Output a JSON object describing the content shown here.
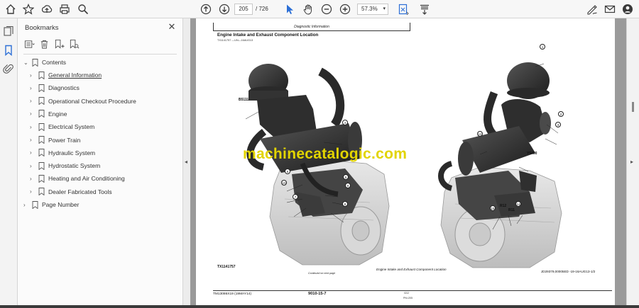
{
  "toolbar": {
    "current_page": "205",
    "page_total": "/ 726",
    "zoom": "57.3%",
    "icons": [
      "home-icon",
      "bookmark-star-icon",
      "upload-icon",
      "print-icon",
      "zoom-search-icon",
      "page-up-icon",
      "page-down-icon",
      "select-cursor-icon",
      "hand-tool-icon",
      "zoom-out-icon",
      "zoom-in-icon",
      "fit-page-icon",
      "scroll-mode-icon",
      "sign-icon",
      "mail-icon",
      "account-icon"
    ]
  },
  "left_rail": {
    "icons": [
      "pages-icon",
      "bookmarks-icon",
      "attachment-icon"
    ]
  },
  "bookmarks": {
    "title": "Bookmarks",
    "root": "Contents",
    "items": [
      {
        "label": "General Information",
        "active": true
      },
      {
        "label": "Diagnostics"
      },
      {
        "label": "Operational Checkout Procedure"
      },
      {
        "label": "Engine"
      },
      {
        "label": "Electrical System"
      },
      {
        "label": "Power Train"
      },
      {
        "label": "Hydraulic System"
      },
      {
        "label": "Hydrostatic System"
      },
      {
        "label": "Heating and Air Conditioning"
      },
      {
        "label": "Dealer Fabricated Tools"
      }
    ],
    "page_number": "Page Number"
  },
  "document": {
    "header": "Diagnostic Information",
    "title": "Engine Intake and Exhaust Component Location",
    "code": "TX1141757 —UN—16AUG13",
    "watermark": "machinecatalogic.com",
    "figure_id": "TX1141757",
    "continued": "Continued on next page",
    "caption": "Engine Intake and Exhaust Component Location",
    "doc_ref": "JD29379,00005ED -19-16AUG13-1/2",
    "footer_left": "TM13086X19 (19MAY14)",
    "footer_center": "9010-15-7",
    "footer_sub": "0212",
    "footer_pn": "PN=205",
    "callouts": {
      "b5111": "B5111",
      "y5400": "Y5400",
      "r12": "R12",
      "r11": "R11",
      "n1": "1",
      "n2": "2",
      "n3": "3",
      "n4": "4",
      "n5": "5",
      "n6": "6",
      "n7": "7",
      "n8": "8",
      "n9": "9",
      "n10": "10",
      "n11": "11",
      "n12": "12",
      "n13": "13",
      "n14": "14",
      "n15": "15"
    }
  }
}
